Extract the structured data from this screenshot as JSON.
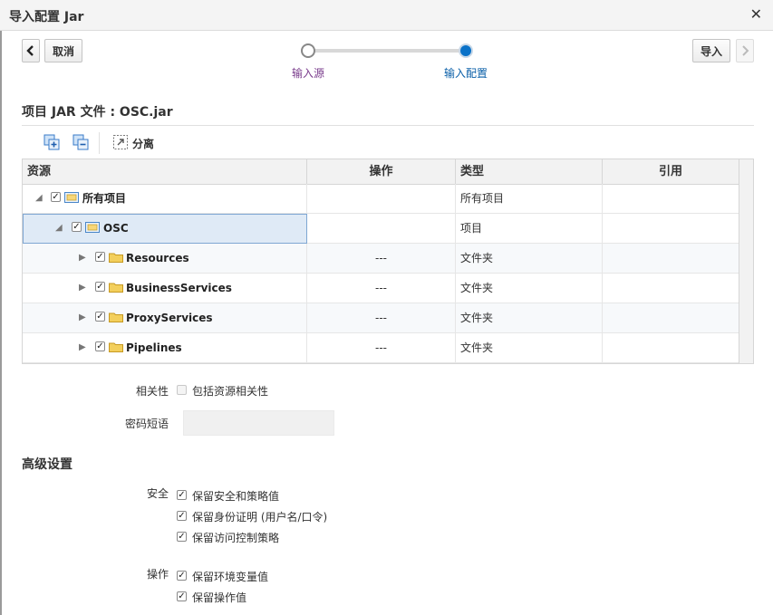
{
  "window": {
    "title": "导入配置 Jar"
  },
  "nav": {
    "cancel_label": "取消",
    "import_label": "导入",
    "steps": [
      {
        "label": "输入源",
        "color": "#7a3c8c"
      },
      {
        "label": "输入配置",
        "color": "#0a5fa8"
      }
    ]
  },
  "section": {
    "title": "项目 JAR 文件 : OSC.jar"
  },
  "toolbar": {
    "detach_label": "分离"
  },
  "table": {
    "headers": [
      "资源",
      "操作",
      "类型",
      "引用"
    ],
    "rows": [
      {
        "name": "所有项目",
        "action": "",
        "type": "所有项目",
        "ref": ""
      },
      {
        "name": "OSC",
        "action": "",
        "type": "项目",
        "ref": ""
      },
      {
        "name": "Resources",
        "action": "---",
        "type": "文件夹",
        "ref": ""
      },
      {
        "name": "BusinessServices",
        "action": "---",
        "type": "文件夹",
        "ref": ""
      },
      {
        "name": "ProxyServices",
        "action": "---",
        "type": "文件夹",
        "ref": ""
      },
      {
        "name": "Pipelines",
        "action": "---",
        "type": "文件夹",
        "ref": ""
      }
    ]
  },
  "dependency": {
    "label": "相关性",
    "option": "包括资源相关性"
  },
  "passphrase": {
    "label": "密码短语",
    "value": ""
  },
  "advanced": {
    "title": "高级设置",
    "security_label": "安全",
    "security_options": [
      "保留安全和策略值",
      "保留身份证明 (用户名/口令)",
      "保留访问控制策略"
    ],
    "ops_label": "操作",
    "ops_options": [
      "保留环境变量值",
      "保留操作值"
    ]
  }
}
